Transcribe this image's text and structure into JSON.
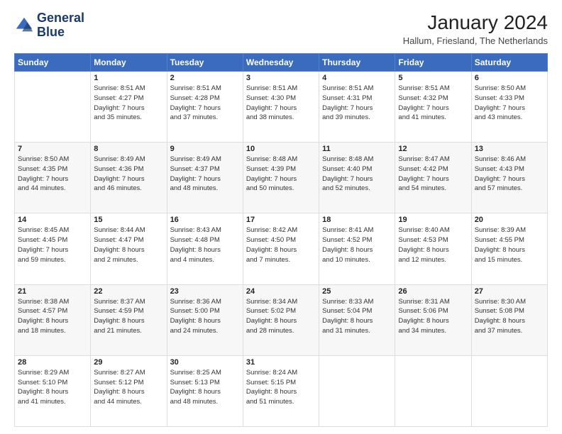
{
  "logo": {
    "line1": "General",
    "line2": "Blue"
  },
  "title": "January 2024",
  "location": "Hallum, Friesland, The Netherlands",
  "days_of_week": [
    "Sunday",
    "Monday",
    "Tuesday",
    "Wednesday",
    "Thursday",
    "Friday",
    "Saturday"
  ],
  "weeks": [
    [
      {
        "day": "",
        "info": ""
      },
      {
        "day": "1",
        "info": "Sunrise: 8:51 AM\nSunset: 4:27 PM\nDaylight: 7 hours\nand 35 minutes."
      },
      {
        "day": "2",
        "info": "Sunrise: 8:51 AM\nSunset: 4:28 PM\nDaylight: 7 hours\nand 37 minutes."
      },
      {
        "day": "3",
        "info": "Sunrise: 8:51 AM\nSunset: 4:30 PM\nDaylight: 7 hours\nand 38 minutes."
      },
      {
        "day": "4",
        "info": "Sunrise: 8:51 AM\nSunset: 4:31 PM\nDaylight: 7 hours\nand 39 minutes."
      },
      {
        "day": "5",
        "info": "Sunrise: 8:51 AM\nSunset: 4:32 PM\nDaylight: 7 hours\nand 41 minutes."
      },
      {
        "day": "6",
        "info": "Sunrise: 8:50 AM\nSunset: 4:33 PM\nDaylight: 7 hours\nand 43 minutes."
      }
    ],
    [
      {
        "day": "7",
        "info": "Sunrise: 8:50 AM\nSunset: 4:35 PM\nDaylight: 7 hours\nand 44 minutes."
      },
      {
        "day": "8",
        "info": "Sunrise: 8:49 AM\nSunset: 4:36 PM\nDaylight: 7 hours\nand 46 minutes."
      },
      {
        "day": "9",
        "info": "Sunrise: 8:49 AM\nSunset: 4:37 PM\nDaylight: 7 hours\nand 48 minutes."
      },
      {
        "day": "10",
        "info": "Sunrise: 8:48 AM\nSunset: 4:39 PM\nDaylight: 7 hours\nand 50 minutes."
      },
      {
        "day": "11",
        "info": "Sunrise: 8:48 AM\nSunset: 4:40 PM\nDaylight: 7 hours\nand 52 minutes."
      },
      {
        "day": "12",
        "info": "Sunrise: 8:47 AM\nSunset: 4:42 PM\nDaylight: 7 hours\nand 54 minutes."
      },
      {
        "day": "13",
        "info": "Sunrise: 8:46 AM\nSunset: 4:43 PM\nDaylight: 7 hours\nand 57 minutes."
      }
    ],
    [
      {
        "day": "14",
        "info": "Sunrise: 8:45 AM\nSunset: 4:45 PM\nDaylight: 7 hours\nand 59 minutes."
      },
      {
        "day": "15",
        "info": "Sunrise: 8:44 AM\nSunset: 4:47 PM\nDaylight: 8 hours\nand 2 minutes."
      },
      {
        "day": "16",
        "info": "Sunrise: 8:43 AM\nSunset: 4:48 PM\nDaylight: 8 hours\nand 4 minutes."
      },
      {
        "day": "17",
        "info": "Sunrise: 8:42 AM\nSunset: 4:50 PM\nDaylight: 8 hours\nand 7 minutes."
      },
      {
        "day": "18",
        "info": "Sunrise: 8:41 AM\nSunset: 4:52 PM\nDaylight: 8 hours\nand 10 minutes."
      },
      {
        "day": "19",
        "info": "Sunrise: 8:40 AM\nSunset: 4:53 PM\nDaylight: 8 hours\nand 12 minutes."
      },
      {
        "day": "20",
        "info": "Sunrise: 8:39 AM\nSunset: 4:55 PM\nDaylight: 8 hours\nand 15 minutes."
      }
    ],
    [
      {
        "day": "21",
        "info": "Sunrise: 8:38 AM\nSunset: 4:57 PM\nDaylight: 8 hours\nand 18 minutes."
      },
      {
        "day": "22",
        "info": "Sunrise: 8:37 AM\nSunset: 4:59 PM\nDaylight: 8 hours\nand 21 minutes."
      },
      {
        "day": "23",
        "info": "Sunrise: 8:36 AM\nSunset: 5:00 PM\nDaylight: 8 hours\nand 24 minutes."
      },
      {
        "day": "24",
        "info": "Sunrise: 8:34 AM\nSunset: 5:02 PM\nDaylight: 8 hours\nand 28 minutes."
      },
      {
        "day": "25",
        "info": "Sunrise: 8:33 AM\nSunset: 5:04 PM\nDaylight: 8 hours\nand 31 minutes."
      },
      {
        "day": "26",
        "info": "Sunrise: 8:31 AM\nSunset: 5:06 PM\nDaylight: 8 hours\nand 34 minutes."
      },
      {
        "day": "27",
        "info": "Sunrise: 8:30 AM\nSunset: 5:08 PM\nDaylight: 8 hours\nand 37 minutes."
      }
    ],
    [
      {
        "day": "28",
        "info": "Sunrise: 8:29 AM\nSunset: 5:10 PM\nDaylight: 8 hours\nand 41 minutes."
      },
      {
        "day": "29",
        "info": "Sunrise: 8:27 AM\nSunset: 5:12 PM\nDaylight: 8 hours\nand 44 minutes."
      },
      {
        "day": "30",
        "info": "Sunrise: 8:25 AM\nSunset: 5:13 PM\nDaylight: 8 hours\nand 48 minutes."
      },
      {
        "day": "31",
        "info": "Sunrise: 8:24 AM\nSunset: 5:15 PM\nDaylight: 8 hours\nand 51 minutes."
      },
      {
        "day": "",
        "info": ""
      },
      {
        "day": "",
        "info": ""
      },
      {
        "day": "",
        "info": ""
      }
    ]
  ]
}
